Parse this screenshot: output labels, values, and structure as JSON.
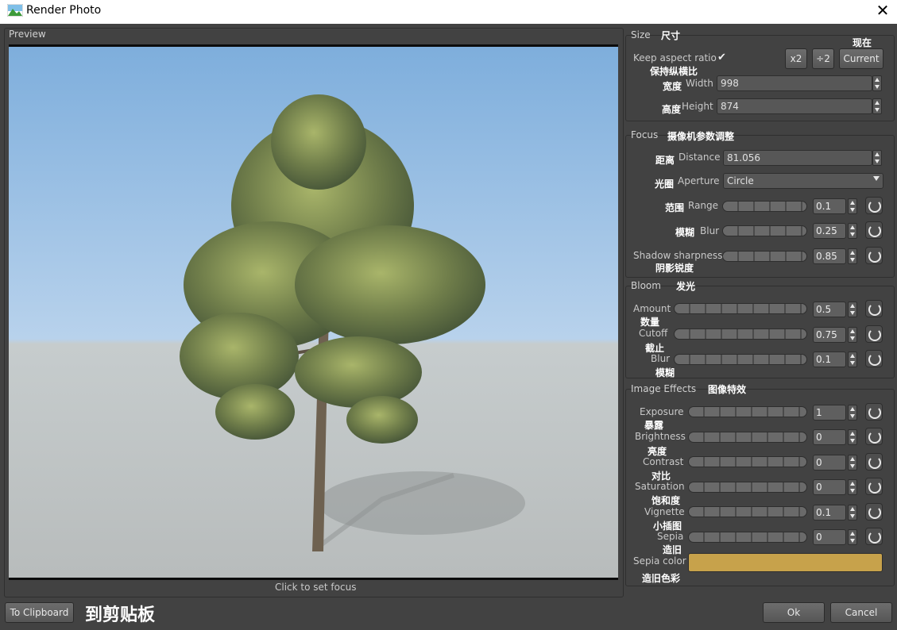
{
  "window": {
    "title": "Render Photo",
    "close_icon": "close-icon"
  },
  "preview": {
    "label": "Preview",
    "hint": "Click to set focus",
    "colors": {
      "sky_top": "#8bb8e2",
      "sky_bottom": "#c7dbee",
      "ground": "#bec3c3"
    }
  },
  "size": {
    "title": "Size",
    "title_zh": "尺寸",
    "keep_aspect_label": "Keep aspect ratio",
    "keep_aspect_zh": "保持纵横比",
    "keep_aspect_checked": true,
    "x2_label": "x2",
    "div2_label": "÷2",
    "current_label": "Current",
    "current_zh": "现在",
    "width_zh": "宽度",
    "width_label": "Width",
    "width_value": "998",
    "height_zh": "高度",
    "height_label": "Height",
    "height_value": "874"
  },
  "focus": {
    "title": "Focus",
    "title_zh": "摄像机参数调整",
    "distance_zh": "距离",
    "distance_label": "Distance",
    "distance_value": "81.056",
    "aperture_zh": "光圈",
    "aperture_label": "Aperture",
    "aperture_value": "Circle",
    "range_zh": "范围",
    "range_label": "Range",
    "range_value": "0.1",
    "blur_zh": "模糊",
    "blur_label": "Blur",
    "blur_value": "0.25",
    "shadow_label": "Shadow sharpness",
    "shadow_zh": "阴影锐度",
    "shadow_value": "0.85"
  },
  "bloom": {
    "title": "Bloom",
    "title_zh": "发光",
    "amount_label": "Amount",
    "amount_zh": "数量",
    "amount_value": "0.5",
    "cutoff_label": "Cutoff",
    "cutoff_zh": "截止",
    "cutoff_value": "0.75",
    "blur_label": "Blur",
    "blur_zh": "模糊",
    "blur_value": "0.1"
  },
  "effects": {
    "title": "Image Effects",
    "title_zh": "图像特效",
    "exposure_label": "Exposure",
    "exposure_zh": "暴露",
    "exposure_value": "1",
    "brightness_label": "Brightness",
    "brightness_zh": "亮度",
    "brightness_value": "0",
    "contrast_label": "Contrast",
    "contrast_zh": "对比",
    "contrast_value": "0",
    "saturation_label": "Saturation",
    "saturation_zh": "饱和度",
    "saturation_value": "0",
    "vignette_label": "Vignette",
    "vignette_zh": "小插图",
    "vignette_value": "0.1",
    "sepia_label": "Sepia",
    "sepia_zh": "造旧",
    "sepia_value": "0",
    "sepia_color_label": "Sepia color",
    "sepia_color_zh": "造旧色彩",
    "sepia_color": "#c7a24b"
  },
  "footer": {
    "clipboard_label": "To Clipboard",
    "clipboard_zh": "到剪贴板",
    "ok_label": "Ok",
    "cancel_label": "Cancel"
  }
}
